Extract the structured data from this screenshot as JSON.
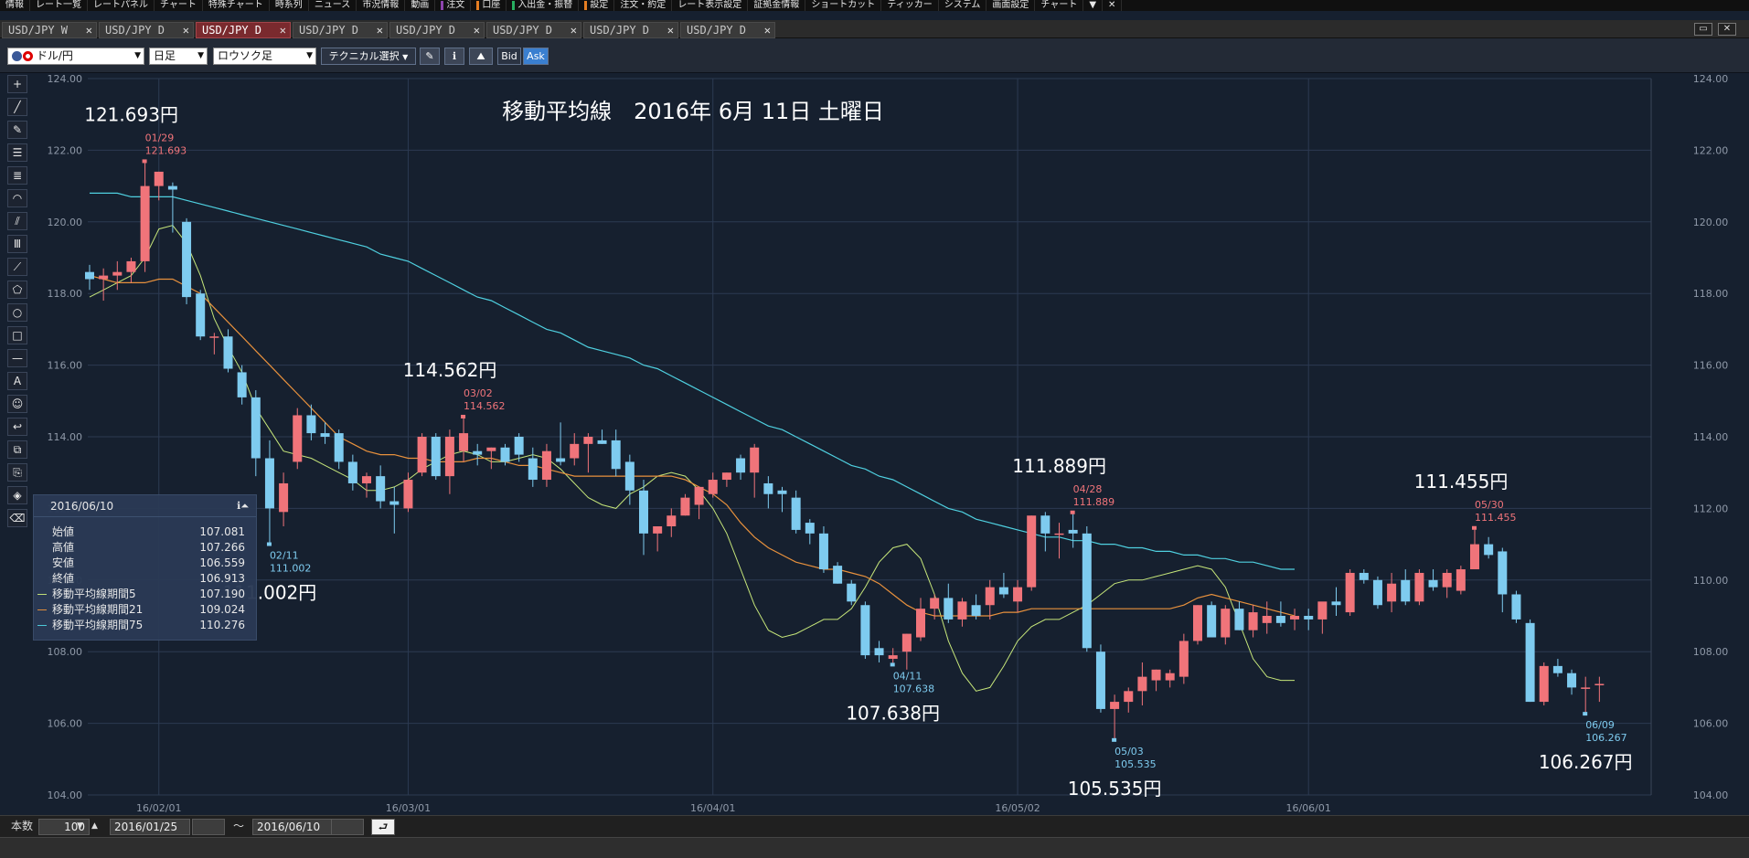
{
  "menubar": {
    "items": [
      {
        "label": "情報",
        "mark": ""
      },
      {
        "label": "レート一覧",
        "mark": ""
      },
      {
        "label": "レートパネル",
        "mark": ""
      },
      {
        "label": "チャート",
        "mark": ""
      },
      {
        "label": "特殊チャート",
        "mark": ""
      },
      {
        "label": "時系列",
        "mark": ""
      },
      {
        "label": "ニュース",
        "mark": ""
      },
      {
        "label": "市況情報",
        "mark": ""
      },
      {
        "label": "動画",
        "mark": ""
      },
      {
        "label": "注文",
        "mark": "#8e44ad"
      },
      {
        "label": "口座",
        "mark": "#e67e22"
      },
      {
        "label": "入出金・振替",
        "mark": "#27ae60"
      },
      {
        "label": "設定",
        "mark": "#e67e22"
      },
      {
        "label": "注文・約定",
        "mark": ""
      },
      {
        "label": "レート表示設定",
        "mark": ""
      },
      {
        "label": "証拠金情報",
        "mark": ""
      },
      {
        "label": "ショートカット",
        "mark": ""
      },
      {
        "label": "ティッカー",
        "mark": ""
      },
      {
        "label": "システム",
        "mark": ""
      },
      {
        "label": "画面設定",
        "mark": ""
      },
      {
        "label": "チャート",
        "mark": ""
      }
    ],
    "dropdown_glyph": "▼",
    "close_glyph": "✕"
  },
  "tabs": [
    {
      "label": "USD/JPY W",
      "active": false
    },
    {
      "label": "USD/JPY D",
      "active": false
    },
    {
      "label": "USD/JPY D",
      "active": true
    },
    {
      "label": "USD/JPY D",
      "active": false
    },
    {
      "label": "USD/JPY D",
      "active": false
    },
    {
      "label": "USD/JPY D",
      "active": false
    },
    {
      "label": "USD/JPY D",
      "active": false
    },
    {
      "label": "USD/JPY D",
      "active": false
    }
  ],
  "tab_close_glyph": "✕",
  "window_buttons": {
    "restore": "▭",
    "close": "✕"
  },
  "toolbar": {
    "pair": "ドル/円",
    "timeframe": "日足",
    "chart_type": "ロウソク足",
    "technical": "テクニカル選択",
    "bid": "Bid",
    "ask": "Ask",
    "caret": "▼"
  },
  "tools": [
    "+",
    "╱",
    "✎",
    "☰",
    "≣",
    "◠",
    "⫽",
    "Ⅲ",
    "⟋",
    "⬠",
    "○",
    "□",
    "—",
    "A",
    "☺",
    "↩",
    "⧉",
    "⎘",
    "◈",
    "⌫"
  ],
  "chart": {
    "title": "移動平均線　2016年 6月 11日 土曜日",
    "annotations": [
      {
        "price": "121.693円",
        "date": "01/29",
        "value": "121.693",
        "kind": "high"
      },
      {
        "price": "111.002円",
        "date": "02/11",
        "value": "111.002",
        "kind": "low"
      },
      {
        "price": "114.562円",
        "date": "03/02",
        "value": "114.562",
        "kind": "high"
      },
      {
        "price": "107.638円",
        "date": "04/11",
        "value": "107.638",
        "kind": "low"
      },
      {
        "price": "111.889円",
        "date": "04/28",
        "value": "111.889",
        "kind": "high"
      },
      {
        "price": "105.535円",
        "date": "05/03",
        "value": "105.535",
        "kind": "low"
      },
      {
        "price": "111.455円",
        "date": "05/30",
        "value": "111.455",
        "kind": "high"
      },
      {
        "price": "106.267円",
        "date": "06/09",
        "value": "106.267",
        "kind": "low"
      }
    ]
  },
  "chart_data": {
    "type": "candlestick",
    "title": "移動平均線　2016年 6月 11日 土曜日",
    "ylim": [
      104,
      124
    ],
    "yticks": [
      "104.00",
      "106.00",
      "108.00",
      "110.00",
      "112.00",
      "114.00",
      "116.00",
      "118.00",
      "120.00",
      "122.00",
      "124.00"
    ],
    "xticks": [
      "16/02/01",
      "16/03/01",
      "16/04/01",
      "16/05/02",
      "16/06/01"
    ],
    "grid": true,
    "colors": {
      "up": "#f0747a",
      "down": "#7ecbef",
      "ma5": "#c6e67a",
      "ma21": "#e8913d",
      "ma75": "#4fd0e0",
      "grid": "#2c3a52",
      "background": "#16202f"
    },
    "series": [
      {
        "name": "移動平均線期間5",
        "values": [
          117.9,
          118.1,
          118.3,
          118.5,
          119.0,
          119.8,
          119.9,
          119.4,
          118.5,
          117.3,
          116.5,
          115.8,
          114.8,
          114.2,
          113.6,
          113.5,
          113.4,
          113.2,
          113.0,
          112.8,
          112.5,
          112.5,
          112.6,
          112.8,
          113.1,
          113.3,
          113.5,
          113.6,
          113.5,
          113.3,
          113.3,
          113.4,
          113.5,
          113.4,
          113.1,
          112.7,
          112.3,
          112.1,
          112.0,
          112.4,
          112.6,
          112.9,
          113.0,
          112.9,
          112.5,
          112.0,
          111.3,
          110.3,
          109.3,
          108.6,
          108.4,
          108.5,
          108.7,
          108.9,
          108.9,
          109.2,
          109.8,
          110.5,
          110.9,
          111.0,
          110.6,
          109.6,
          108.3,
          107.4,
          106.9,
          107.0,
          107.6,
          108.3,
          108.7,
          108.9,
          108.9,
          109.1,
          109.3,
          109.6,
          109.9,
          110.0,
          110.0,
          110.1,
          110.2,
          110.3,
          110.4,
          110.3,
          109.8,
          108.8,
          107.8,
          107.3,
          107.2,
          107.2
        ],
        "note": ""
      },
      {
        "name": "移動平均線期間21",
        "values": [
          118.5,
          118.4,
          118.3,
          118.3,
          118.3,
          118.4,
          118.4,
          118.2,
          118.0,
          117.6,
          117.2,
          116.8,
          116.4,
          116.0,
          115.6,
          115.2,
          114.8,
          114.4,
          114.0,
          113.8,
          113.6,
          113.5,
          113.5,
          113.4,
          113.4,
          113.3,
          113.3,
          113.3,
          113.4,
          113.4,
          113.3,
          113.2,
          113.2,
          113.1,
          113.0,
          112.9,
          112.9,
          112.9,
          112.9,
          112.9,
          112.9,
          112.9,
          112.9,
          112.8,
          112.6,
          112.4,
          112.1,
          111.6,
          111.2,
          110.9,
          110.7,
          110.5,
          110.4,
          110.3,
          110.3,
          110.2,
          110.1,
          109.9,
          109.6,
          109.3,
          109.1,
          109.0,
          109.0,
          109.0,
          109.0,
          109.0,
          109.1,
          109.1,
          109.2,
          109.2,
          109.2,
          109.2,
          109.2,
          109.2,
          109.2,
          109.2,
          109.2,
          109.2,
          109.2,
          109.3,
          109.5,
          109.6,
          109.5,
          109.4,
          109.3,
          109.2,
          109.1,
          109.0
        ]
      },
      {
        "name": "移動平均線期間75",
        "values": [
          120.8,
          120.8,
          120.8,
          120.7,
          120.7,
          120.7,
          120.7,
          120.6,
          120.5,
          120.4,
          120.3,
          120.2,
          120.1,
          120.0,
          119.9,
          119.8,
          119.7,
          119.6,
          119.5,
          119.4,
          119.3,
          119.1,
          119.0,
          118.9,
          118.7,
          118.5,
          118.3,
          118.1,
          117.9,
          117.8,
          117.6,
          117.4,
          117.2,
          117.0,
          116.9,
          116.7,
          116.5,
          116.4,
          116.3,
          116.2,
          116.0,
          115.9,
          115.7,
          115.5,
          115.3,
          115.1,
          114.9,
          114.7,
          114.5,
          114.3,
          114.2,
          114.0,
          113.8,
          113.6,
          113.4,
          113.2,
          113.1,
          112.9,
          112.8,
          112.6,
          112.4,
          112.2,
          112.0,
          111.9,
          111.7,
          111.6,
          111.5,
          111.4,
          111.3,
          111.2,
          111.2,
          111.1,
          111.1,
          111.0,
          111.0,
          110.9,
          110.9,
          110.8,
          110.8,
          110.7,
          110.7,
          110.6,
          110.6,
          110.5,
          110.5,
          110.4,
          110.3,
          110.3
        ]
      }
    ],
    "candles": [
      [
        118.6,
        118.8,
        118.1,
        118.4
      ],
      [
        118.4,
        118.7,
        117.8,
        118.5
      ],
      [
        118.5,
        118.9,
        118.1,
        118.6
      ],
      [
        118.6,
        119.0,
        118.3,
        118.9
      ],
      [
        118.9,
        121.693,
        118.6,
        121.0
      ],
      [
        121.0,
        121.4,
        120.6,
        121.4
      ],
      [
        121.0,
        121.1,
        119.7,
        120.9
      ],
      [
        120.0,
        120.1,
        117.7,
        117.9
      ],
      [
        118.0,
        118.1,
        116.7,
        116.8
      ],
      [
        116.8,
        116.9,
        116.3,
        116.8
      ],
      [
        116.8,
        117.0,
        115.8,
        115.9
      ],
      [
        115.8,
        116.0,
        114.9,
        115.1
      ],
      [
        115.1,
        115.3,
        112.9,
        113.4
      ],
      [
        113.4,
        113.9,
        111.002,
        112.0
      ],
      [
        111.9,
        113.0,
        111.5,
        112.7
      ],
      [
        113.3,
        114.8,
        113.1,
        114.6
      ],
      [
        114.6,
        114.9,
        113.9,
        114.1
      ],
      [
        114.1,
        114.4,
        113.8,
        114.0
      ],
      [
        114.1,
        114.2,
        113.1,
        113.3
      ],
      [
        113.3,
        113.5,
        112.5,
        112.7
      ],
      [
        112.7,
        113.0,
        112.3,
        112.9
      ],
      [
        112.9,
        113.2,
        112.0,
        112.2
      ],
      [
        112.2,
        112.6,
        111.3,
        112.1
      ],
      [
        112.0,
        113.0,
        111.9,
        112.8
      ],
      [
        113.0,
        114.1,
        112.9,
        114.0
      ],
      [
        114.0,
        114.1,
        112.8,
        112.9
      ],
      [
        112.9,
        114.2,
        112.4,
        114.0
      ],
      [
        113.6,
        114.562,
        113.3,
        114.1
      ],
      [
        113.6,
        113.8,
        113.2,
        113.5
      ],
      [
        113.6,
        113.7,
        113.1,
        113.7
      ],
      [
        113.7,
        113.8,
        113.2,
        113.3
      ],
      [
        114.0,
        114.1,
        113.3,
        113.5
      ],
      [
        113.4,
        113.7,
        112.6,
        112.8
      ],
      [
        112.8,
        113.8,
        112.6,
        113.6
      ],
      [
        113.4,
        114.4,
        113.2,
        113.3
      ],
      [
        113.4,
        114.1,
        113.2,
        113.8
      ],
      [
        113.8,
        114.1,
        113.0,
        114.0
      ],
      [
        113.9,
        114.2,
        113.8,
        113.8
      ],
      [
        113.9,
        114.2,
        112.9,
        113.1
      ],
      [
        113.3,
        113.5,
        112.1,
        112.5
      ],
      [
        112.5,
        112.8,
        110.7,
        111.3
      ],
      [
        111.3,
        111.5,
        110.8,
        111.5
      ],
      [
        111.5,
        112.0,
        111.2,
        111.8
      ],
      [
        111.8,
        112.4,
        111.8,
        112.3
      ],
      [
        112.1,
        112.6,
        111.7,
        112.6
      ],
      [
        112.4,
        113.0,
        112.3,
        112.8
      ],
      [
        112.8,
        113.0,
        112.6,
        113.0
      ],
      [
        113.4,
        113.5,
        112.8,
        113.0
      ],
      [
        113.0,
        113.8,
        112.3,
        113.7
      ],
      [
        112.7,
        112.9,
        112.0,
        112.4
      ],
      [
        112.5,
        112.6,
        111.9,
        112.4
      ],
      [
        112.3,
        112.5,
        111.3,
        111.4
      ],
      [
        111.6,
        111.7,
        111.0,
        111.3
      ],
      [
        111.3,
        111.5,
        110.2,
        110.3
      ],
      [
        110.4,
        110.5,
        109.9,
        109.9
      ],
      [
        109.9,
        110.0,
        109.3,
        109.4
      ],
      [
        109.3,
        109.4,
        107.8,
        107.9
      ],
      [
        108.1,
        108.3,
        107.7,
        107.9
      ],
      [
        107.8,
        108.1,
        107.638,
        107.9
      ],
      [
        108.0,
        108.5,
        107.5,
        108.5
      ],
      [
        108.4,
        109.5,
        108.3,
        109.2
      ],
      [
        109.2,
        109.6,
        108.9,
        109.5
      ],
      [
        109.5,
        109.9,
        108.8,
        108.9
      ],
      [
        108.9,
        109.5,
        108.7,
        109.4
      ],
      [
        109.3,
        109.6,
        108.9,
        109.0
      ],
      [
        109.3,
        110.0,
        108.9,
        109.8
      ],
      [
        109.8,
        110.2,
        109.5,
        109.6
      ],
      [
        109.4,
        110.0,
        109.1,
        109.8
      ],
      [
        109.8,
        111.8,
        109.7,
        111.8
      ],
      [
        111.8,
        111.9,
        110.8,
        111.3
      ],
      [
        111.3,
        111.6,
        110.6,
        111.3
      ],
      [
        111.4,
        111.889,
        110.9,
        111.3
      ],
      [
        111.3,
        111.5,
        108.0,
        108.1
      ],
      [
        108.0,
        108.2,
        106.3,
        106.4
      ],
      [
        106.4,
        106.8,
        105.535,
        106.6
      ],
      [
        106.6,
        107.0,
        106.3,
        106.9
      ],
      [
        106.9,
        107.7,
        106.5,
        107.3
      ],
      [
        107.2,
        107.5,
        106.9,
        107.5
      ],
      [
        107.2,
        107.5,
        107.0,
        107.4
      ],
      [
        107.3,
        108.5,
        107.1,
        108.3
      ],
      [
        108.3,
        109.3,
        108.2,
        109.3
      ],
      [
        109.3,
        109.4,
        108.4,
        108.4
      ],
      [
        108.4,
        109.3,
        108.2,
        109.2
      ],
      [
        109.2,
        109.4,
        108.6,
        108.6
      ],
      [
        108.6,
        109.3,
        108.4,
        109.1
      ],
      [
        108.8,
        109.4,
        108.5,
        109.0
      ],
      [
        109.0,
        109.4,
        108.7,
        108.8
      ],
      [
        108.9,
        109.2,
        108.6,
        109.0
      ],
      [
        109.0,
        109.2,
        108.6,
        108.9
      ],
      [
        108.9,
        109.3,
        108.5,
        109.4
      ],
      [
        109.4,
        109.8,
        109.0,
        109.3
      ],
      [
        109.1,
        110.3,
        109.0,
        110.2
      ],
      [
        110.2,
        110.3,
        109.9,
        110.0
      ],
      [
        110.0,
        110.1,
        109.2,
        109.3
      ],
      [
        109.4,
        110.2,
        109.1,
        109.9
      ],
      [
        110.0,
        110.3,
        109.3,
        109.4
      ],
      [
        109.4,
        110.3,
        109.3,
        110.2
      ],
      [
        110.0,
        110.3,
        109.7,
        109.8
      ],
      [
        109.8,
        110.3,
        109.5,
        110.2
      ],
      [
        109.7,
        110.4,
        109.6,
        110.3
      ],
      [
        110.3,
        111.455,
        110.3,
        111.0
      ],
      [
        111.0,
        111.2,
        110.6,
        110.7
      ],
      [
        110.8,
        110.9,
        109.1,
        109.6
      ],
      [
        109.6,
        109.7,
        108.8,
        108.9
      ],
      [
        108.8,
        108.9,
        106.6,
        106.6
      ],
      [
        106.6,
        107.7,
        106.5,
        107.6
      ],
      [
        107.6,
        107.8,
        107.3,
        107.4
      ],
      [
        107.4,
        107.5,
        106.8,
        107.0
      ],
      [
        107.0,
        107.3,
        106.267,
        107.0
      ],
      [
        107.1,
        107.3,
        106.6,
        107.1
      ]
    ]
  },
  "info_panel": {
    "date": "2016/06/10",
    "rows": [
      {
        "label": "始値",
        "value": "107.081"
      },
      {
        "label": "高値",
        "value": "107.266"
      },
      {
        "label": "安値",
        "value": "106.559"
      },
      {
        "label": "終値",
        "value": "106.913"
      },
      {
        "label": "移動平均線期間5",
        "value": "107.190",
        "color": "#c6e67a"
      },
      {
        "label": "移動平均線期間21",
        "value": "109.024",
        "color": "#e8913d"
      },
      {
        "label": "移動平均線期間75",
        "value": "110.276",
        "color": "#4fd0e0"
      }
    ],
    "icons": "ℹ⏶"
  },
  "bottombar": {
    "count_label": "本数",
    "count_value": "100",
    "start_date": "2016/01/25",
    "separator": "〜",
    "end_date": "2016/06/10",
    "reset_glyph": "⮐"
  }
}
